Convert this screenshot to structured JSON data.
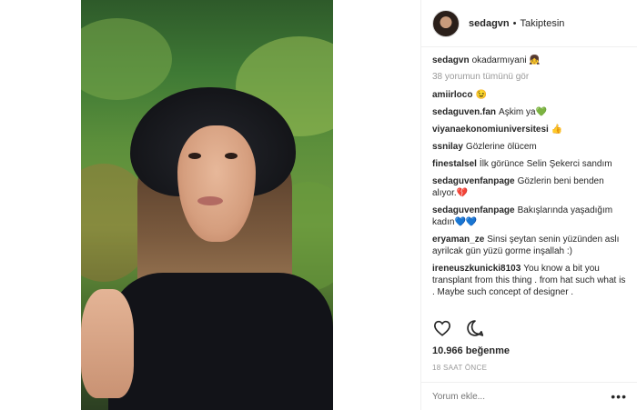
{
  "header": {
    "username": "sedagvn",
    "separator": "•",
    "follow_status": "Takiptesin"
  },
  "caption": {
    "user": "sedagvn",
    "text": "okadarmıyani 👧"
  },
  "view_all": "38 yorumun tümünü gör",
  "comments": [
    {
      "user": "amiirloco",
      "text": "😉"
    },
    {
      "user": "sedaguven.fan",
      "text": "Aşkim ya💚"
    },
    {
      "user": "viyanaekonomiuniversitesi",
      "text": "👍"
    },
    {
      "user": "ssnilay",
      "text": "Gözlerine ölücem"
    },
    {
      "user": "finestalsel",
      "text": "İlk görünce Selin Şekerci sandım"
    },
    {
      "user": "sedaguvenfanpage",
      "text": "Gözlerin beni benden alıyor.💔"
    },
    {
      "user": "sedaguvenfanpage",
      "text": "Bakışlarında yaşadığım kadın💙💙"
    },
    {
      "user": "eryaman_ze",
      "text": "Sinsi şeytan senin yüzünden aslı ayrilcak gün yüzü gorme inşallah :)"
    },
    {
      "user": "ireneuszkunicki8103",
      "text": "You know a bit you transplant from this thing . from hat such what is . Maybe such concept of designer ."
    }
  ],
  "likes": "10.966 beğenme",
  "time": "18 SAAT ÖNCE",
  "comment_input": {
    "placeholder": "Yorum ekle..."
  },
  "more_menu": "•••",
  "icons": {
    "like": "heart-icon",
    "comment": "comment-bubble-icon"
  }
}
